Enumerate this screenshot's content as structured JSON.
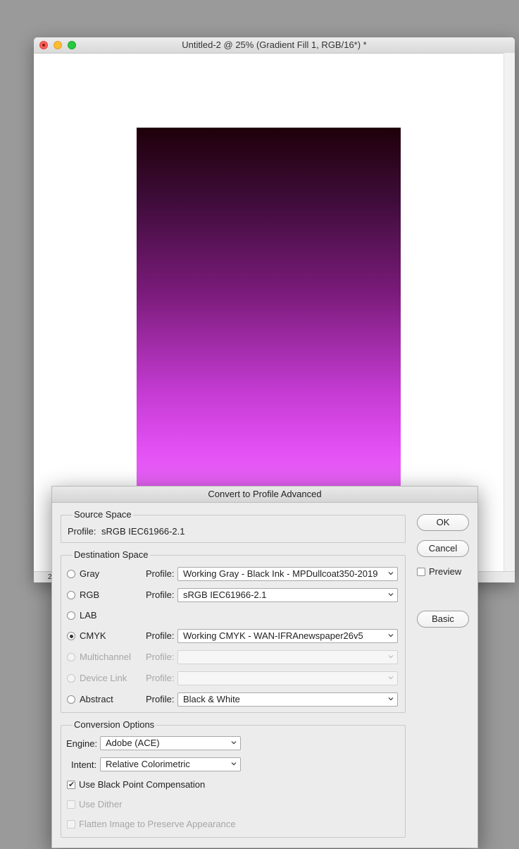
{
  "document": {
    "title": "Untitled-2 @ 25% (Gradient Fill 1, RGB/16*) *",
    "status_fragment": "2"
  },
  "dialog": {
    "title": "Convert to Profile Advanced",
    "source_space": {
      "label": "Source Space",
      "profile_label": "Profile:",
      "profile_value": "sRGB IEC61966-2.1"
    },
    "destination_space": {
      "label": "Destination Space",
      "profile_label": "Profile:",
      "rows": [
        {
          "mode": "Gray",
          "profile": "Working Gray - Black Ink - MPDullcoat350-2019",
          "selected": false,
          "enabled": true
        },
        {
          "mode": "RGB",
          "profile": "sRGB IEC61966-2.1",
          "selected": false,
          "enabled": true
        },
        {
          "mode": "LAB",
          "profile": "",
          "selected": false,
          "enabled": true
        },
        {
          "mode": "CMYK",
          "profile": "Working CMYK - WAN-IFRAnewspaper26v5",
          "selected": true,
          "enabled": true
        },
        {
          "mode": "Multichannel",
          "profile": "",
          "selected": false,
          "enabled": false
        },
        {
          "mode": "Device Link",
          "profile": "",
          "selected": false,
          "enabled": false
        },
        {
          "mode": "Abstract",
          "profile": "Black & White",
          "selected": false,
          "enabled": true
        }
      ]
    },
    "conversion_options": {
      "label": "Conversion Options",
      "engine_label": "Engine:",
      "engine_value": "Adobe (ACE)",
      "intent_label": "Intent:",
      "intent_value": "Relative Colorimetric",
      "checkboxes": [
        {
          "label": "Use Black Point Compensation",
          "checked": true,
          "enabled": true
        },
        {
          "label": "Use Dither",
          "checked": false,
          "enabled": false
        },
        {
          "label": "Flatten Image to Preserve Appearance",
          "checked": false,
          "enabled": false
        }
      ]
    },
    "buttons": {
      "ok": "OK",
      "cancel": "Cancel",
      "basic": "Basic",
      "preview_label": "Preview"
    }
  }
}
